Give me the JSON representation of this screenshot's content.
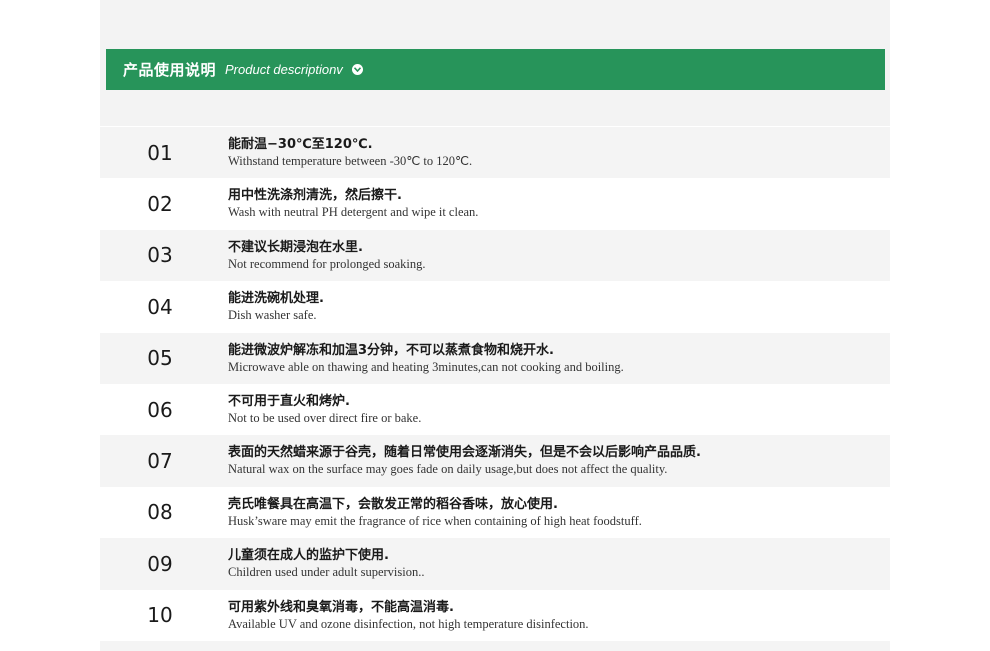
{
  "header": {
    "title_cn": "产品使用说明",
    "title_en": "Product descriptionv",
    "icon": "chevron-down-circle-icon",
    "background_color": "#27945a"
  },
  "items": [
    {
      "number": "01",
      "cn": "能耐温−30℃至120℃.",
      "en": "Withstand temperature between -30℃ to 120℃."
    },
    {
      "number": "02",
      "cn": "用中性洗涤剂清洗，然后擦干.",
      "en": "Wash with neutral PH detergent and wipe it clean."
    },
    {
      "number": "03",
      "cn": "不建议长期浸泡在水里.",
      "en": "Not recommend for prolonged soaking."
    },
    {
      "number": "04",
      "cn": "能进洗碗机处理.",
      "en": "Dish washer safe."
    },
    {
      "number": "05",
      "cn": "能进微波炉解冻和加温3分钟，不可以蒸煮食物和烧开水.",
      "en": "Microwave able on thawing and heating 3minutes,can not cooking and boiling."
    },
    {
      "number": "06",
      "cn": "不可用于直火和烤炉.",
      "en": "Not to be used over direct fire or bake."
    },
    {
      "number": "07",
      "cn": "表面的天然蜡来源于谷壳，随着日常使用会逐渐消失，但是不会以后影响产品品质.",
      "en": "Natural wax on the surface may goes fade on daily usage,but does not affect the quality."
    },
    {
      "number": "08",
      "cn": "壳氏唯餐具在高温下，会散发正常的稻谷香味，放心使用.",
      "en": "Husk’sware may emit the fragrance of rice when containing of high heat foodstuff."
    },
    {
      "number": "09",
      "cn": "儿童须在成人的监护下使用.",
      "en": "Children used under adult supervision.."
    },
    {
      "number": "10",
      "cn": "可用紫外线和臭氧消毒，不能高温消毒.",
      "en": "Available UV and ozone disinfection, not high temperature disinfection."
    }
  ]
}
